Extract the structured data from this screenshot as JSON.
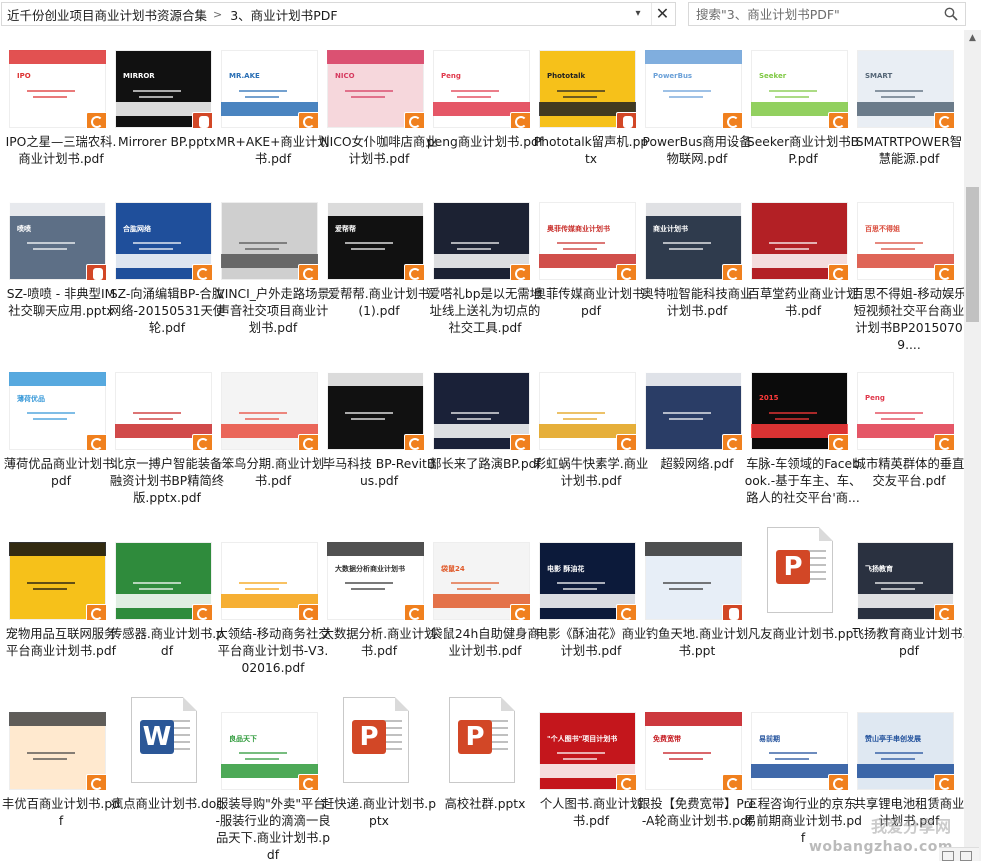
{
  "breadcrumb": {
    "items": [
      "近千份创业项目商业计划书资源合集",
      "3、商业计划书PDF"
    ],
    "separator": ">"
  },
  "search": {
    "placeholder": "搜索\"3、商业计划书PDF\""
  },
  "icons": {
    "dropdown": "chevron-down-icon",
    "close": "close-icon",
    "search": "search-icon",
    "pdf_badge": "pdf-badge-icon",
    "ppt_badge": "ppt-badge-icon"
  },
  "colors": {
    "pdf_badge": "#f0801e",
    "ppt_badge": "#d24726",
    "word_icon": "#2b5797"
  },
  "watermark": {
    "cn": "我爱分享网",
    "url": "wobangzhao.com"
  },
  "files": [
    {
      "label": "IPO之星—三瑞农科.商业计划书.pdf",
      "type": "pdf",
      "thumb": "IPO"
    },
    {
      "label": "Mirrorer BP.pptx",
      "type": "pptx",
      "thumb": "MIRROR"
    },
    {
      "label": "MR+AKE+商业计划书.pdf",
      "type": "pdf",
      "thumb": "MR.AKE"
    },
    {
      "label": "NICO女仆咖啡店商业计划书.pdf",
      "type": "pdf",
      "thumb": "NICO"
    },
    {
      "label": "peng商业计划书.pdf",
      "type": "pdf",
      "thumb": "Peng"
    },
    {
      "label": "Phototalk留声机.pptx",
      "type": "pptx",
      "thumb": "Phototalk"
    },
    {
      "label": "PowerBus商用设备物联网.pdf",
      "type": "pdf",
      "thumb": "PowerBus"
    },
    {
      "label": "Seeker商业计划书BP.pdf",
      "type": "pdf",
      "thumb": "Seeker"
    },
    {
      "label": "SMATRTPOWER智慧能源.pdf",
      "type": "pdf",
      "thumb": "SMART"
    },
    {
      "label": "SZ-喷喷 - 非典型IM社交聊天应用.pptx",
      "type": "pptx",
      "thumb": "喷喷"
    },
    {
      "label": "SZ-向涌编辑BP-合肱网络-20150531天使轮.pdf",
      "type": "pdf",
      "thumb": "合肱网络"
    },
    {
      "label": "VINCI_户外走路场景声音社交项目商业计划书.pdf",
      "type": "pdf",
      "thumb": ""
    },
    {
      "label": "爱帮帮.商业计划书(1).pdf",
      "type": "pdf",
      "thumb": "爱帮帮"
    },
    {
      "label": "爱嗒礼bp是以无需地址线上送礼为切点的社交工具.pdf",
      "type": "pdf",
      "thumb": ""
    },
    {
      "label": "奥菲传媒商业计划书.pdf",
      "type": "pdf",
      "thumb": "奥菲传媒商业计划书"
    },
    {
      "label": "奥特啦智能科技商业计划书.pdf",
      "type": "pdf",
      "thumb": "商业计划书"
    },
    {
      "label": "百草堂药业商业计划书.pdf",
      "type": "pdf",
      "thumb": ""
    },
    {
      "label": "百思不得姐-移动娱乐短视频社交平台商业计划书BP20150709....",
      "type": "pdf",
      "thumb": "百思不得姐"
    },
    {
      "label": "薄荷优品商业计划书.pdf",
      "type": "pdf",
      "thumb": "薄荷优品"
    },
    {
      "label": "北京一搏户智能装备融资计划书BP精简终版.pptx.pdf",
      "type": "pdf",
      "thumb": ""
    },
    {
      "label": "笨鸟分期.商业计划书.pdf",
      "type": "pdf",
      "thumb": ""
    },
    {
      "label": "毕马科技 BP-RevitBus.pdf",
      "type": "pdf",
      "thumb": ""
    },
    {
      "label": "部长来了路演BP.pdf",
      "type": "pdf",
      "thumb": ""
    },
    {
      "label": "彩虹蜗牛快素学.商业计划书.pdf",
      "type": "pdf",
      "thumb": ""
    },
    {
      "label": "超毅网络.pdf",
      "type": "pdf",
      "thumb": ""
    },
    {
      "label": "车脉-车领域的Facebook.-基于车主、车、路人的社交平台'商...",
      "type": "pdf",
      "thumb": "2015"
    },
    {
      "label": "城市精英群体的垂直交友平台.pdf",
      "type": "pdf",
      "thumb": "Peng"
    },
    {
      "label": "宠物用品互联网服务平台商业计划书.pdf",
      "type": "pdf",
      "thumb": ""
    },
    {
      "label": "传感器.商业计划书.pdf",
      "type": "pdf",
      "thumb": ""
    },
    {
      "label": "大领结-移动商务社交平台商业计划书-V3.02016.pdf",
      "type": "pdf",
      "thumb": ""
    },
    {
      "label": "大数据分析.商业计划书.pdf",
      "type": "pdf",
      "thumb": "大数据分析商业计划书"
    },
    {
      "label": "袋鼠24h自助健身商业计划书.pdf",
      "type": "pdf",
      "thumb": "袋鼠24"
    },
    {
      "label": "电影《酥油花》商业计划书.pdf",
      "type": "pdf",
      "thumb": "电影 酥油花"
    },
    {
      "label": "钓鱼天地.商业计划书.ppt",
      "type": "ppt",
      "thumb": ""
    },
    {
      "label": "凡友商业计划书.ppt",
      "type": "ppt",
      "thumb": ""
    },
    {
      "label": "飞扬教育商业计划书.pdf",
      "type": "pdf",
      "thumb": "飞扬教育"
    },
    {
      "label": "丰优百商业计划书.pdf",
      "type": "pdf",
      "thumb": ""
    },
    {
      "label": "疯点商业计划书.doc",
      "type": "doc",
      "thumb": ""
    },
    {
      "label": "服装导购\"外卖\"平台--服装行业的滴滴一良品天下.商业计划书.pdf",
      "type": "pdf",
      "thumb": "良品天下"
    },
    {
      "label": "赶快递.商业计划书.pptx",
      "type": "pptx",
      "thumb": ""
    },
    {
      "label": "高校社群.pptx",
      "type": "pptx",
      "thumb": ""
    },
    {
      "label": "个人图书.商业计划书.pdf",
      "type": "pdf",
      "thumb": "\"个人图书\"项目计划书"
    },
    {
      "label": "跟投【免费宽带】Pre-A轮商业计划书.pdf",
      "type": "pdf",
      "thumb": "免费宽带"
    },
    {
      "label": "工程咨询行业的京东-易前期商业计划书.pdf",
      "type": "pdf",
      "thumb": "易前期"
    },
    {
      "label": "共享锂电池租赁商业计划书.pdf",
      "type": "pdf",
      "thumb": "赞山亭手串创发展"
    }
  ]
}
